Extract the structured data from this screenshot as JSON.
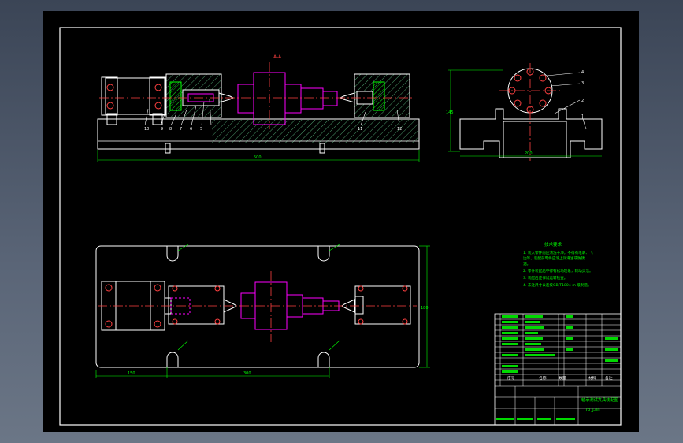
{
  "drawing": {
    "section_label": "A-A",
    "part_balloons_front": [
      "10",
      "9",
      "8",
      "7",
      "6",
      "5",
      "4",
      "3",
      "2",
      "1",
      "11",
      "12"
    ],
    "part_balloons_side": [
      "4",
      "3",
      "2",
      "1"
    ],
    "dim_front_overall": "500",
    "dim_side_width": "200",
    "dim_side_height": "145",
    "dim_plan_height": "180",
    "dim_plan_left": "150",
    "dim_plan_mid": "300",
    "tech_req_title": "技术要求",
    "tech_req_lines": [
      "1. 装入零件前应清洗干净，不得有毛刺、飞",
      "   边等，装配前零件应涂上润滑油或防锈",
      "   油。",
      "2. 零件装配后不得有松动现象，转动灵活。",
      "3. 装配后应作试运转检查。",
      "4. 未注尺寸公差按GB/T1804-m 级制造。"
    ],
    "title_block": {
      "drawing_title": "轴承测试夹具装配图",
      "drawing_number": "GLJJ-00",
      "header_seq": "序号",
      "header_name": "名称",
      "header_qty": "数量",
      "header_material": "材料",
      "header_note": "备注"
    }
  }
}
